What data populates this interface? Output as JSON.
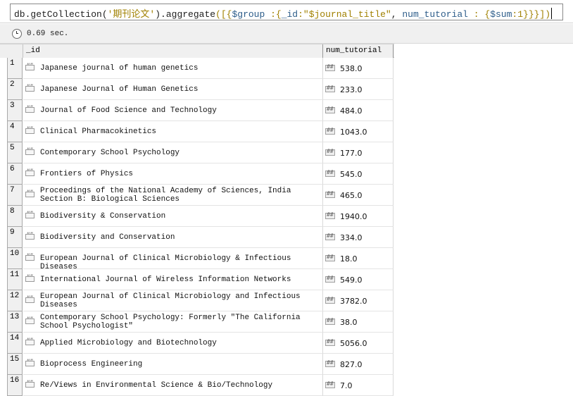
{
  "query": {
    "prefix": "db.getCollection(",
    "collection": "'期刊论文'",
    "mid": ").aggregate",
    "pipeline_open": "([{",
    "group_key": "$group",
    "colon": " :{",
    "id_key": "_id",
    "id_colon": ":",
    "id_value": "\"$journal_title\"",
    "comma": ", ",
    "field_key": "num_tutorial",
    "field_colon": " : {",
    "sum_key": "$sum",
    "sum_value": ":1",
    "close": "}}}])"
  },
  "status": {
    "elapsed": "0.69 sec."
  },
  "columns": {
    "id": "_id",
    "num": "num_tutorial"
  },
  "rows": [
    {
      "n": "1",
      "id": "Japanese journal of human genetics",
      "num": "538.0"
    },
    {
      "n": "2",
      "id": "Japanese Journal of Human Genetics",
      "num": "233.0"
    },
    {
      "n": "3",
      "id": "Journal of Food Science and Technology",
      "num": "484.0"
    },
    {
      "n": "4",
      "id": "Clinical Pharmacokinetics",
      "num": "1043.0"
    },
    {
      "n": "5",
      "id": "Contemporary School Psychology",
      "num": "177.0"
    },
    {
      "n": "6",
      "id": "Frontiers of Physics",
      "num": "545.0"
    },
    {
      "n": "7",
      "id": "Proceedings of the National Academy of Sciences, India Section B: Biological Sciences",
      "num": "465.0"
    },
    {
      "n": "8",
      "id": "Biodiversity & Conservation",
      "num": "1940.0"
    },
    {
      "n": "9",
      "id": "Biodiversity and Conservation",
      "num": "334.0"
    },
    {
      "n": "10",
      "id": "European Journal of Clinical Microbiology & Infectious Diseases",
      "num": "18.0"
    },
    {
      "n": "11",
      "id": "International Journal of Wireless Information Networks",
      "num": "549.0"
    },
    {
      "n": "12",
      "id": "European Journal of Clinical Microbiology and Infectious Diseases",
      "num": "3782.0"
    },
    {
      "n": "13",
      "id": "Contemporary School Psychology: Formerly \"The California School Psychologist\"",
      "num": "38.0"
    },
    {
      "n": "14",
      "id": "Applied Microbiology and Biotechnology",
      "num": "5056.0"
    },
    {
      "n": "15",
      "id": "Bioprocess Engineering",
      "num": "827.0"
    },
    {
      "n": "16",
      "id": "Re/Views in Environmental Science & Bio/Technology",
      "num": "7.0"
    }
  ],
  "icons": {
    "status": "clock-icon",
    "string_type": "string-type-icon",
    "number_type": "number-type-icon"
  }
}
